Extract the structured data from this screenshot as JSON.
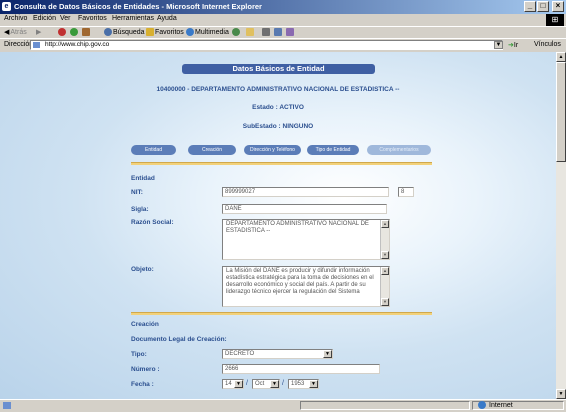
{
  "window": {
    "title": "Consulta de Datos Básicos de Entidades - Microsoft Internet Explorer"
  },
  "menu": [
    "Archivo",
    "Edición",
    "Ver",
    "Favoritos",
    "Herramientas",
    "Ayuda"
  ],
  "toolbar": {
    "back": "Atrás",
    "search": "Búsqueda",
    "favorites": "Favoritos",
    "multimedia": "Multimedia"
  },
  "address": {
    "label": "Dirección",
    "url": "http://www.chip.gov.co",
    "go": "Ir",
    "links": "Vínculos"
  },
  "page": {
    "banner": "Datos Básicos de Entidad",
    "entity_heading": "10400000 - DEPARTAMENTO ADMINISTRATIVO NACIONAL DE ESTADISTICA --",
    "estado": "Estado : ACTIVO",
    "subestado": "SubEstado : NINGUNO",
    "tabs": [
      "Entidad",
      "Creación",
      "Dirección y Teléfono",
      "Tipo de Entidad",
      "Complementarios"
    ],
    "section_entidad": "Entidad",
    "nit_label": "NIT:",
    "nit_value": "899999027",
    "nit_dv": "8",
    "sigla_label": "Sigla:",
    "sigla_value": "DANE",
    "razon_label": "Razón Social:",
    "razon_value": "DEPARTAMENTO ADMINISTRATIVO NACIONAL DE ESTADISTICA --",
    "objeto_label": "Objeto:",
    "objeto_value": "La Misión del DANE es producir y difundir información estadística estratégica para la toma de decisiones en el desarrollo económico y social del país. A partir de su liderazgo técnico ejercer la regulación del Sistema",
    "section_creacion": "Creación",
    "doc_legal_label": "Documento Legal de Creación:",
    "tipo_label": "Tipo:",
    "tipo_value": "DECRETO",
    "numero_label": "Número :",
    "numero_value": "2666",
    "fecha_label": "Fecha :",
    "fecha_day": "14",
    "fecha_month": "Oct",
    "fecha_year": "1953",
    "fecha_sep": "/"
  },
  "status": {
    "zone": "Internet"
  },
  "colors": {
    "banner": "#3f5fa3",
    "label": "#2b4f8f",
    "divider": "#f2d17a"
  }
}
